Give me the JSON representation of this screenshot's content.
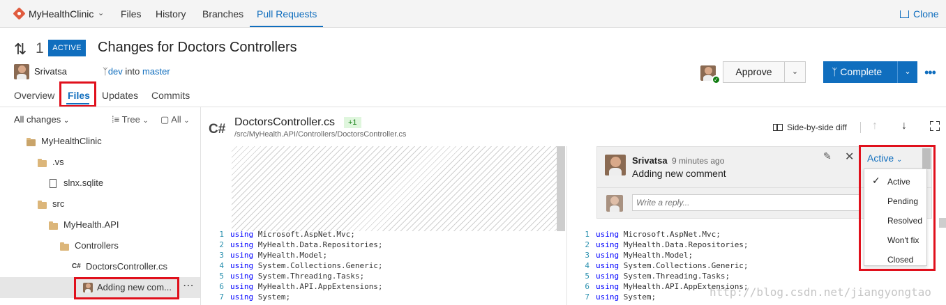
{
  "topnav": {
    "repo_name": "MyHealthClinic",
    "links": [
      "Files",
      "History",
      "Branches",
      "Pull Requests"
    ],
    "clone_label": "Clone"
  },
  "pr": {
    "number": "1",
    "status": "ACTIVE",
    "title": "Changes for Doctors Controllers",
    "author": "Srivatsa",
    "source_branch": "dev",
    "into_text": "into",
    "target_branch": "master"
  },
  "actions": {
    "approve": "Approve",
    "complete": "Complete"
  },
  "tabs": [
    "Overview",
    "Files",
    "Updates",
    "Commits"
  ],
  "filters": {
    "changes": "All changes",
    "view": "Tree",
    "scope": "All"
  },
  "tree": [
    {
      "label": "MyHealthClinic",
      "type": "repo"
    },
    {
      "label": ".vs",
      "type": "folder"
    },
    {
      "label": "slnx.sqlite",
      "type": "file"
    },
    {
      "label": "src",
      "type": "folder"
    },
    {
      "label": "MyHealth.API",
      "type": "folder"
    },
    {
      "label": "Controllers",
      "type": "folder"
    },
    {
      "label": "DoctorsController.cs",
      "type": "cs"
    },
    {
      "label": "Adding new com...",
      "type": "comment"
    }
  ],
  "file": {
    "lang_glyph": "C#",
    "name": "DoctorsController.cs",
    "change_count": "+1",
    "path": "/src/MyHealth.API/Controllers/DoctorsController.cs"
  },
  "diff": {
    "view_label": "Side-by-side diff",
    "lines": [
      {
        "num": "1",
        "kw": "using",
        "text": " Microsoft.AspNet.Mvc;"
      },
      {
        "num": "2",
        "kw": "using",
        "text": " MyHealth.Data.Repositories;"
      },
      {
        "num": "3",
        "kw": "using",
        "text": " MyHealth.Model;"
      },
      {
        "num": "4",
        "kw": "using",
        "text": " System.Collections.Generic;"
      },
      {
        "num": "5",
        "kw": "using",
        "text": " System.Threading.Tasks;"
      },
      {
        "num": "6",
        "kw": "using",
        "text": " MyHealth.API.AppExtensions;"
      },
      {
        "num": "7",
        "kw": "using",
        "text": " System;"
      }
    ]
  },
  "comment": {
    "author": "Srivatsa",
    "time": "9 minutes ago",
    "body": "Adding new comment",
    "reply_placeholder": "Write a reply..."
  },
  "status_dropdown": {
    "current": "Active",
    "options": [
      "Active",
      "Pending",
      "Resolved",
      "Won't fix",
      "Closed"
    ],
    "checked": "Active"
  },
  "watermark": "http://blog.csdn.net/jiangyongtao",
  "colors": {
    "accent": "#106ebe",
    "highlight_box": "#e0101c",
    "success": "#107c10"
  }
}
